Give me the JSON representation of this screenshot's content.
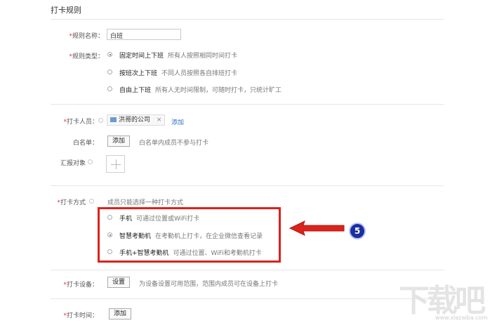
{
  "page_title": "打卡规则",
  "rule_name": {
    "label": "规则名称：",
    "value": "白班"
  },
  "rule_type": {
    "label": "规则类型：",
    "options": [
      {
        "name": "固定时间上下班",
        "desc": "所有人按照相同时间打卡",
        "selected": true
      },
      {
        "name": "按班次上下班",
        "desc": "不同人员按照各自排班打卡",
        "selected": false
      },
      {
        "name": "自由上下班",
        "desc": "所有人无时间限制，可随时打卡，只统计旷工",
        "selected": false
      }
    ]
  },
  "members": {
    "label": "打卡人员：",
    "tag": "洪哥的公司",
    "tag_close": "×",
    "add": "添加"
  },
  "whitelist": {
    "label": "白名单：",
    "button": "添加",
    "note": "白名单内成员不参与打卡"
  },
  "report_to": {
    "label": "汇报对象"
  },
  "checkin_method": {
    "label": "打卡方式",
    "note": "成员只能选择一种打卡方式",
    "options": [
      {
        "name": "手机",
        "desc": "可通过位置或WiFi打卡",
        "selected": false
      },
      {
        "name": "智慧考勤机",
        "desc": "在考勤机上打卡，在企业微信查看记录",
        "selected": true
      },
      {
        "name": "手机+智慧考勤机",
        "desc": "可通过位置、WiFi和考勤机打卡",
        "selected": false
      }
    ]
  },
  "device": {
    "label": "打卡设备：",
    "button": "设置",
    "note": "为设备设置可用范围，范围内成员可在设备上打卡"
  },
  "checkin_time": {
    "label": "打卡时间：",
    "button": "添加"
  },
  "annotation": {
    "step": "5",
    "color": "#d9231b"
  },
  "watermark": {
    "logo": "下载吧",
    "site": "www.xiazaiba.com"
  }
}
